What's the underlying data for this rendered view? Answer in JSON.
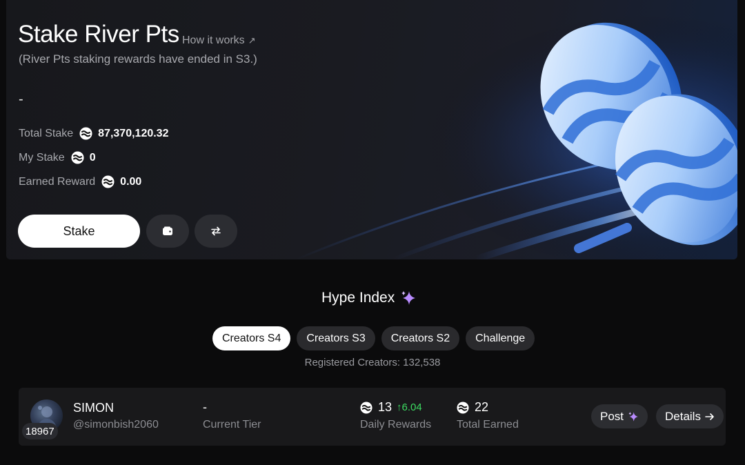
{
  "stake": {
    "title": "Stake River Pts",
    "how_it_works": "How it works",
    "how_it_works_icon": "arrow-up-right-icon",
    "note": "(River Pts staking rewards have ended in S3.)",
    "apr": "-",
    "total_stake_label": "Total Stake",
    "total_stake_value": "87,370,120.32",
    "my_stake_label": "My Stake",
    "my_stake_value": "0",
    "earned_label": "Earned Reward",
    "earned_value": "0.00",
    "stake_button": "Stake",
    "wallet_icon": "wallet-icon",
    "swap_icon": "swap-arrows-icon",
    "coin_icon": "river-pts-coin-icon"
  },
  "hype": {
    "title": "Hype Index",
    "title_icon": "sparkle-icon",
    "tabs": [
      {
        "label": "Creators S4",
        "active": true
      },
      {
        "label": "Creators S3",
        "active": false
      },
      {
        "label": "Creators S2",
        "active": false
      },
      {
        "label": "Challenge",
        "active": false
      }
    ],
    "registered": "Registered Creators: 132,538"
  },
  "creator": {
    "rank": "18967",
    "name": "SIMON",
    "handle": "@simonbish2060",
    "tier_value": "-",
    "tier_label": "Current Tier",
    "daily_value": "13",
    "daily_delta": "6.04",
    "daily_label": "Daily Rewards",
    "total_value": "22",
    "total_label": "Total Earned",
    "post_button": "Post",
    "details_button": "Details"
  },
  "colors": {
    "accent_green": "#3ddc62",
    "sparkle_purple": "#b98cff",
    "coin_blue": "#4a90e2"
  }
}
